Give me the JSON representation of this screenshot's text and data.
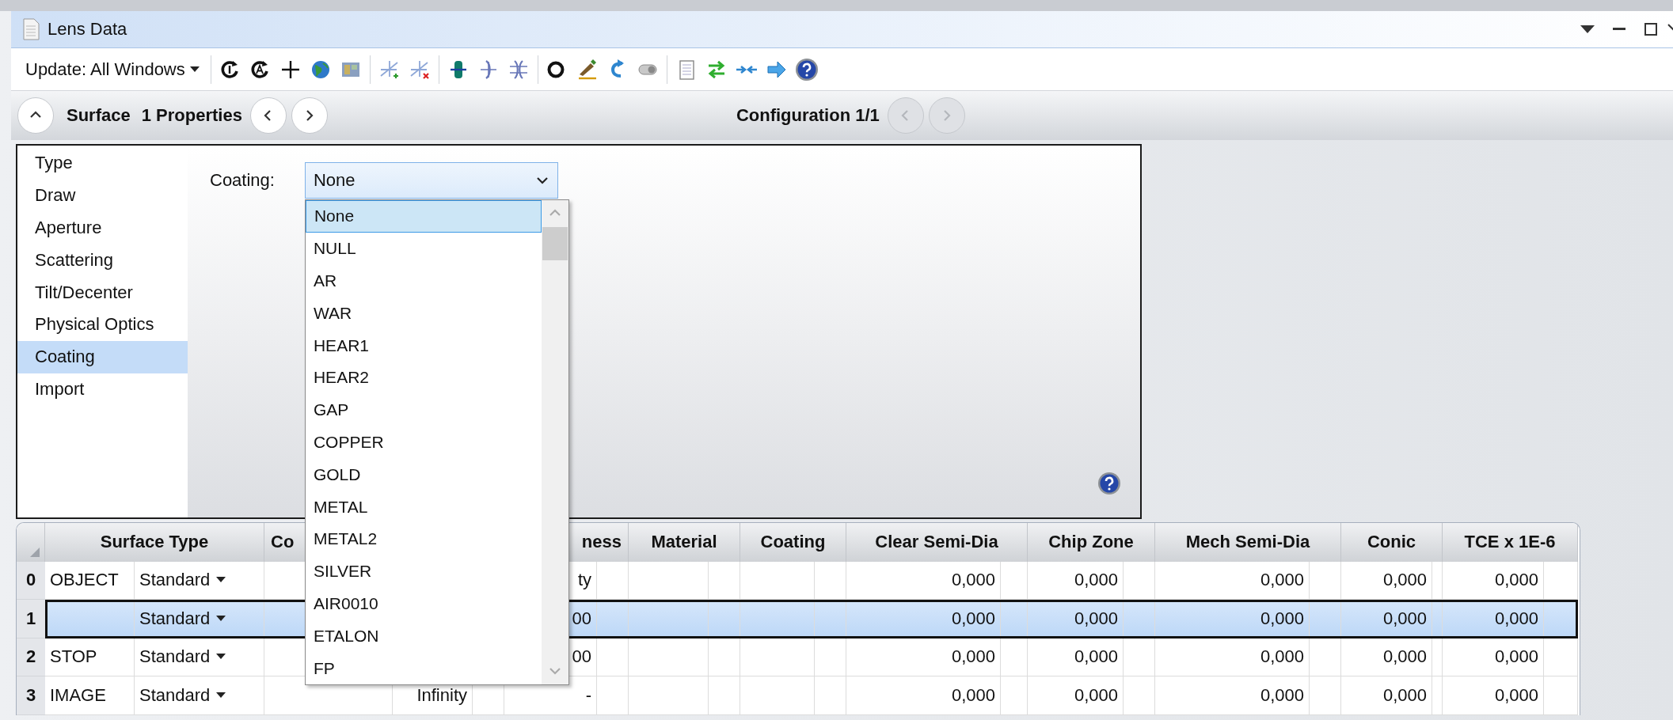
{
  "window": {
    "title": "Lens Data"
  },
  "toolbar": {
    "update_menu": "Update: All Windows"
  },
  "nav": {
    "surface_label": "Surface",
    "properties_label": "1 Properties",
    "surface_nav": {
      "disabled": false
    },
    "configuration_label": "Configuration 1/1",
    "configuration_nav": {
      "disabled": true
    }
  },
  "property_list": {
    "items": [
      {
        "label": "Type",
        "selected": false
      },
      {
        "label": "Draw",
        "selected": false
      },
      {
        "label": "Aperture",
        "selected": false
      },
      {
        "label": "Scattering",
        "selected": false
      },
      {
        "label": "Tilt/Decenter",
        "selected": false
      },
      {
        "label": "Physical Optics",
        "selected": false
      },
      {
        "label": "Coating",
        "selected": true
      },
      {
        "label": "Import",
        "selected": false
      }
    ]
  },
  "coating": {
    "label": "Coating:",
    "value": "None",
    "options": [
      {
        "label": "None",
        "selected": true
      },
      {
        "label": "NULL",
        "selected": false
      },
      {
        "label": "AR",
        "selected": false
      },
      {
        "label": "WAR",
        "selected": false
      },
      {
        "label": "HEAR1",
        "selected": false
      },
      {
        "label": "HEAR2",
        "selected": false
      },
      {
        "label": "GAP",
        "selected": false
      },
      {
        "label": "COPPER",
        "selected": false
      },
      {
        "label": "GOLD",
        "selected": false
      },
      {
        "label": "METAL",
        "selected": false
      },
      {
        "label": "METAL2",
        "selected": false
      },
      {
        "label": "SILVER",
        "selected": false
      },
      {
        "label": "AIR0010",
        "selected": false
      },
      {
        "label": "ETALON",
        "selected": false
      },
      {
        "label": "FP",
        "selected": false
      }
    ]
  },
  "table": {
    "headers": {
      "surface_type": "Surface Type",
      "comment": "Co",
      "thickness": "ness",
      "material": "Material",
      "coating": "Coating",
      "clear_semi_dia": "Clear Semi-Dia",
      "chip_zone": "Chip Zone",
      "mech_semi_dia": "Mech Semi-Dia",
      "conic": "Conic",
      "tce": "TCE x 1E-6"
    },
    "rows": [
      {
        "number": "0",
        "name": "OBJECT",
        "type": "Standard",
        "selected": false,
        "thickness": "ty",
        "clear_semi_dia": "0,000",
        "chip_zone": "0,000",
        "mech_semi_dia": "0,000",
        "conic": "0,000",
        "tce": "0,000"
      },
      {
        "number": "1",
        "type": "Standard",
        "selected": true,
        "thickness": "00",
        "clear_semi_dia": "0,000",
        "chip_zone": "0,000",
        "mech_semi_dia": "0,000",
        "conic": "0,000",
        "tce": "0,000"
      },
      {
        "number": "2",
        "name": "STOP",
        "type": "Standard",
        "selected": false,
        "thickness": "00",
        "clear_semi_dia": "0,000",
        "chip_zone": "0,000",
        "mech_semi_dia": "0,000",
        "conic": "0,000",
        "tce": "0,000"
      },
      {
        "number": "3",
        "name": "IMAGE",
        "type": "Standard",
        "selected": false,
        "radius": "Infinity",
        "thickness": "-",
        "clear_semi_dia": "0,000",
        "chip_zone": "0,000",
        "mech_semi_dia": "0,000",
        "conic": "0,000",
        "tce": "0,000"
      }
    ]
  }
}
